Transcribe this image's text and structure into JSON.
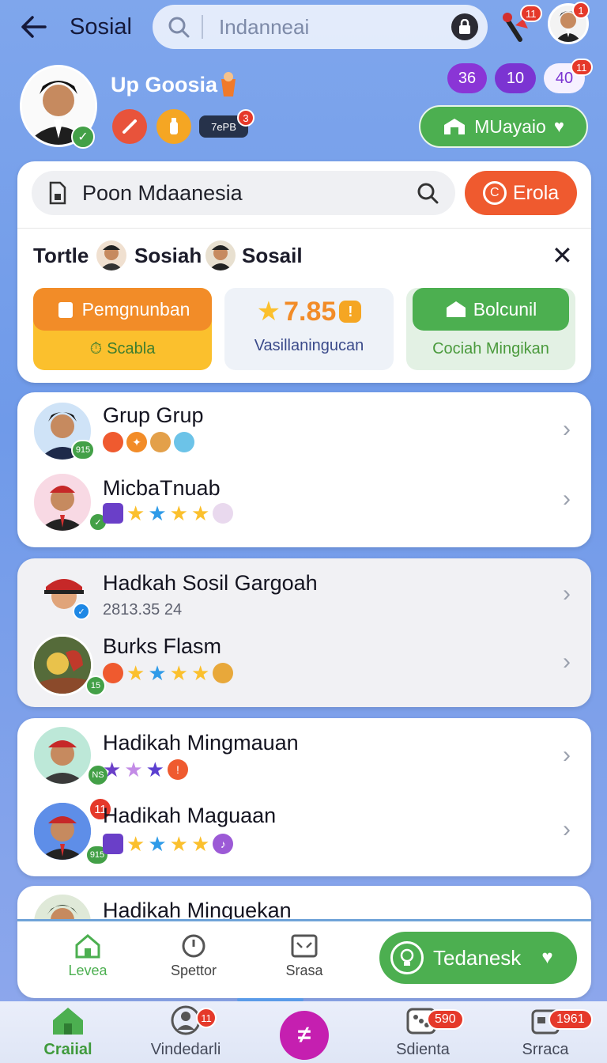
{
  "header": {
    "title": "Sosial",
    "search_placeholder": "Indanneai",
    "top_badge_1": "11",
    "top_badge_2": "1"
  },
  "profile": {
    "name": "Up Goosia",
    "chip_text": "7ePB",
    "chip_badge": "3",
    "counters": [
      "36",
      "10",
      "40"
    ],
    "counter_badge": "11",
    "action_label": "MUayaio"
  },
  "panel": {
    "search_value": "Poon Mdaanesia",
    "search_button": "Erola",
    "tags": [
      "Tortle",
      "Sosiah",
      "Sosail"
    ],
    "tiles": [
      {
        "button": "Pemgnunban",
        "caption": "Scabla"
      },
      {
        "value": "7.85",
        "caption": "Vasillaningucan"
      },
      {
        "button": "Bolcunil",
        "caption": "Cociah Mingikan"
      }
    ]
  },
  "lists": [
    {
      "title": "Grup Grup",
      "avatar_badge": "915"
    },
    {
      "title": "MicbaTnuab"
    },
    {
      "title": "Hadkah Sosil Gargoah",
      "subtitle": "2813.35 24"
    },
    {
      "title": "Burks Flasm",
      "avatar_badge": "15"
    },
    {
      "title": "Hadikah Mingmauan",
      "avatar_badge": "NS"
    },
    {
      "title": "Hadikah Maguaan",
      "avatar_badge": "915",
      "corner_badge": "11"
    },
    {
      "title": "Hadikah Minguekan"
    }
  ],
  "tabs": [
    "Levea",
    "Spettor",
    "Srasa"
  ],
  "tab_action": "Tedanesk",
  "bottom_nav": [
    {
      "label": "Craiial",
      "badge": ""
    },
    {
      "label": "Vindedarli",
      "badge": "11"
    },
    {
      "label": "",
      "badge": ""
    },
    {
      "label": "Sdienta",
      "badge": "590"
    },
    {
      "label": "Srraca",
      "badge": "1961"
    }
  ],
  "colors": {
    "accent_green": "#4caf50",
    "accent_orange": "#f05a2a",
    "accent_purple": "#8e3ad6",
    "background": "#7fa6ec"
  }
}
